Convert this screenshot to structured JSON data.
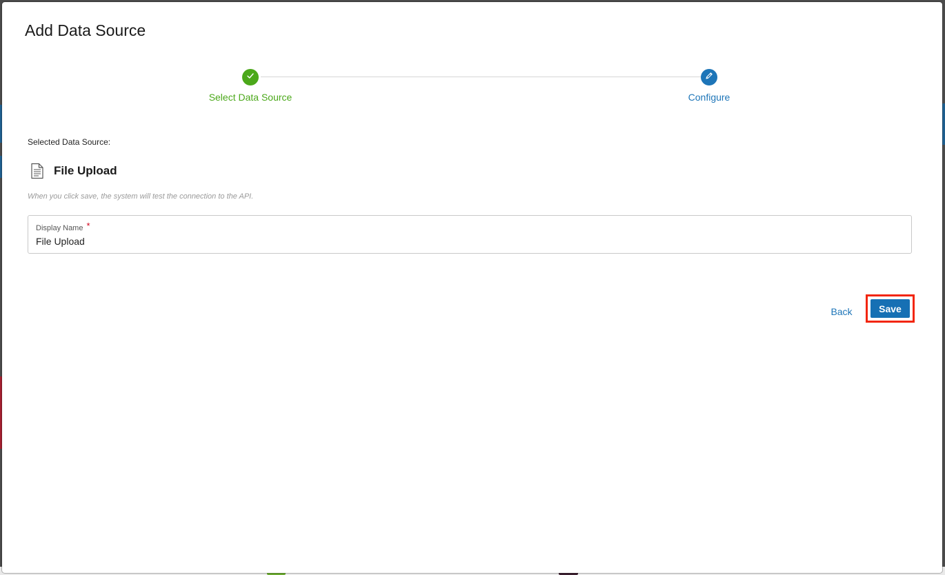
{
  "modal": {
    "title": "Add Data Source"
  },
  "stepper": {
    "steps": [
      {
        "label": "Select Data Source",
        "state": "completed",
        "icon": "check-icon",
        "color": "#4ba81a"
      },
      {
        "label": "Configure",
        "state": "active",
        "icon": "pencil-icon",
        "color": "#1d75b8"
      }
    ]
  },
  "selection": {
    "label": "Selected Data Source:",
    "source_name": "File Upload",
    "source_icon": "document-icon",
    "hint": "When you click save, the system will test the connection to the API."
  },
  "form": {
    "display_name_label": "Display Name",
    "display_name_value": "File Upload",
    "required_marker": "*"
  },
  "actions": {
    "back_label": "Back",
    "save_label": "Save"
  },
  "colors": {
    "accent": "#1670b4",
    "success": "#4ba81a",
    "highlight": "#f2250b",
    "required": "#d0021b"
  }
}
